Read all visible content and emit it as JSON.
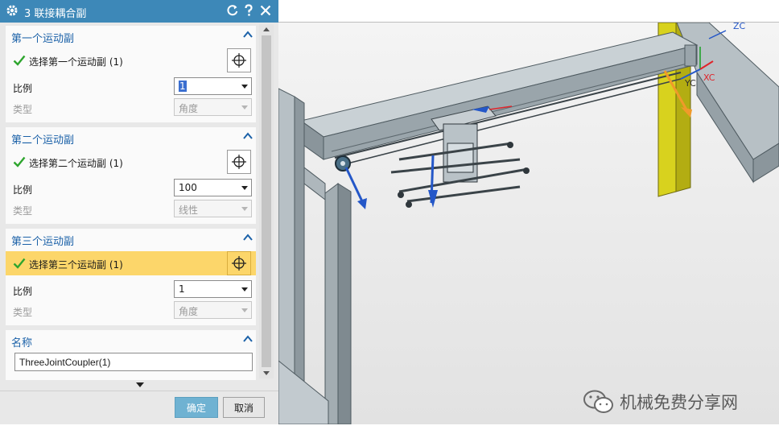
{
  "dialog": {
    "title": "3 联接耦合副",
    "buttons": {
      "ok": "确定",
      "cancel": "取消"
    }
  },
  "sections": [
    {
      "title": "第一个运动副",
      "select_label": "选择第一个运动副 (1)",
      "ratio_label": "比例",
      "ratio_value": "1",
      "type_label": "类型",
      "type_value": "角度"
    },
    {
      "title": "第二个运动副",
      "select_label": "选择第二个运动副 (1)",
      "ratio_label": "比例",
      "ratio_value": "100",
      "type_label": "类型",
      "type_value": "线性"
    },
    {
      "title": "第三个运动副",
      "select_label": "选择第三个运动副 (1)",
      "ratio_label": "比例",
      "ratio_value": "1",
      "type_label": "类型",
      "type_value": "角度"
    }
  ],
  "name_section": {
    "title": "名称",
    "value": "ThreeJointCoupler(1)"
  },
  "viewport": {
    "axes": {
      "zc": "ZC",
      "yc": "YC",
      "xc": "XC"
    }
  },
  "watermark": "机械免费分享网",
  "colors": {
    "titlebar": "#3d88b8",
    "section_title": "#1b61a8",
    "active_row": "#fcd66a",
    "check": "#2ea52e",
    "ok_button": "#6fb2d2",
    "frame_steel": "#a9b3b8",
    "yellow_column": "#d8d21e",
    "handle_blue": "#2457c8",
    "handle_orange": "#f09a2a"
  },
  "icons": {
    "settings": "gear-icon",
    "reset": "reset-icon",
    "help": "help-icon",
    "close": "close-icon",
    "collapse": "chevron-up-icon",
    "check": "check-icon",
    "select": "crosshair-icon",
    "dropdown": "chevron-down-icon",
    "more": "expand-more-icon",
    "watermark": "wechat-icon"
  }
}
